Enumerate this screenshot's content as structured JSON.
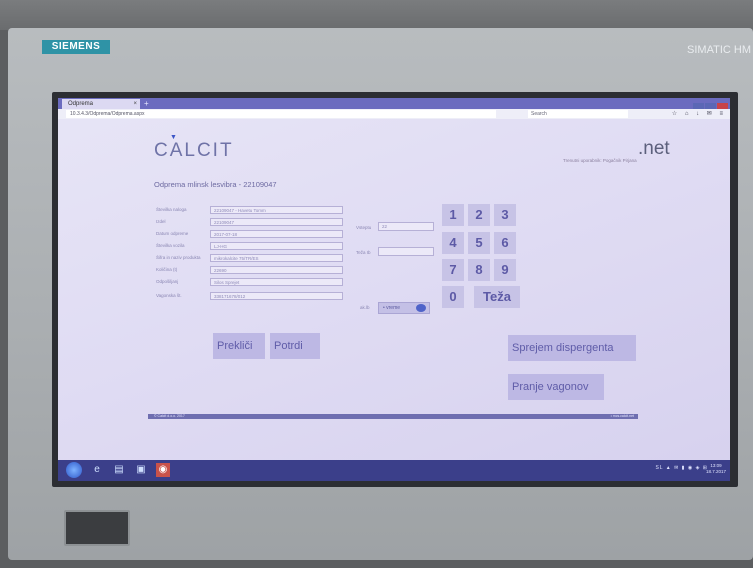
{
  "hardware": {
    "brand_left": "SIEMENS",
    "brand_right": "SIMATIC HM"
  },
  "browser": {
    "tab_title": "Odprema",
    "tab_close": "×",
    "new_tab": "+",
    "url": "10.3.4.3/Odprema/Odprema.aspx",
    "search_placeholder": "Search",
    "toolbar_glyphs": "☆ ⌂ ↓ ✉ ≡"
  },
  "app": {
    "logo": "CALCIT",
    "domain": ".net",
    "user_info": "Trenutni uporabnik: Pogačnik Pirjana",
    "page_title": "Odprema mlinsk lesvibra - 22109047"
  },
  "form": {
    "fields": [
      {
        "label": "Številka naloga",
        "value": "22109047 - Havetu Tomm"
      },
      {
        "label": "Izdel",
        "value": "22109047"
      },
      {
        "label": "Datum odpreme",
        "value": "2017-07-18"
      },
      {
        "label": "Številka vozila",
        "value": "LJ-HG"
      },
      {
        "label": "Šifra in naziv produkta",
        "value": "mikrokalcite 75/TR/ES"
      },
      {
        "label": "Količina (t)",
        "value": "22690"
      },
      {
        "label": "Odpošiljanj",
        "value": "Silos Sprejet"
      },
      {
        "label": "Vagonska št.",
        "value": "338171678/012"
      }
    ],
    "tara_label": "Vsteptu",
    "tara_value": "22",
    "teza_label": "Teža Ib",
    "teza_value": "",
    "send_label": "ak.lb",
    "send_button": "• vreme"
  },
  "keypad": {
    "keys": [
      "1",
      "2",
      "3",
      "4",
      "5",
      "6",
      "7",
      "8",
      "9",
      "0"
    ],
    "weight_key": "Teža"
  },
  "actions": {
    "cancel": "Prekliči",
    "confirm": "Potrdi",
    "receive_dispergent": "Sprejem dispergenta",
    "wash_wagons": "Pranje vagonov"
  },
  "status": {
    "left": "© Calcit d.o.o. 2017",
    "right": "• mcs.calcit.net"
  },
  "taskbar": {
    "tray": "SL ▲ ✉ ▮ ◉ ◈ ⊞",
    "time": "13:09",
    "date": "18.7.2017"
  },
  "colors": {
    "accent": "#6b6bbf",
    "button_bg": "#bdb8e4",
    "button_text": "#5f5ca8",
    "siemens_teal": "#2f93a6"
  }
}
